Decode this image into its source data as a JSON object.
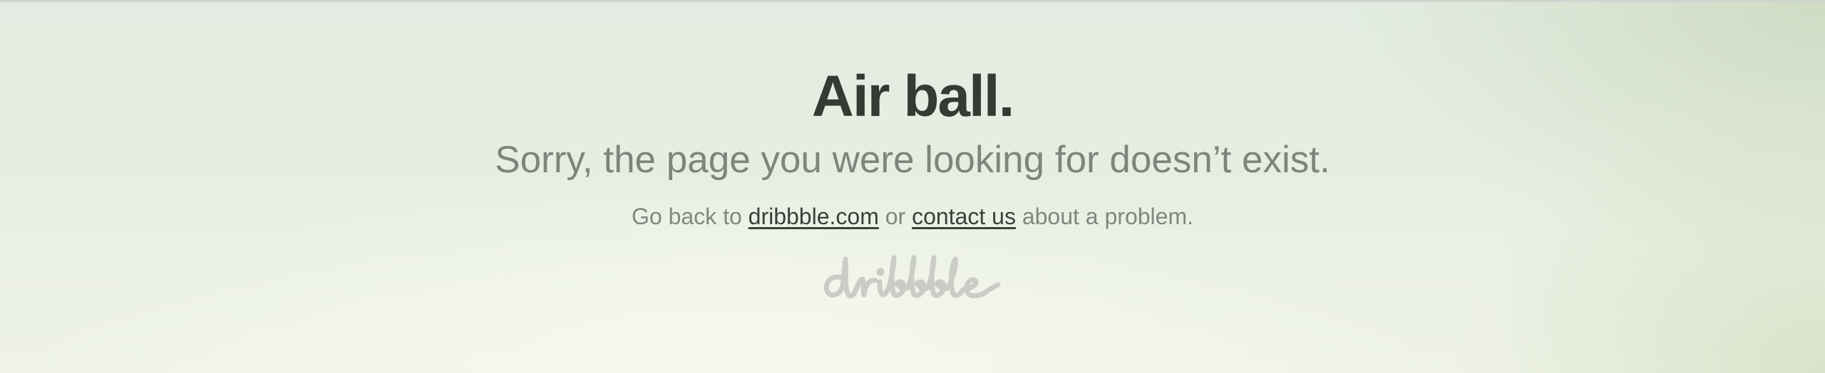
{
  "page": {
    "title": "Air ball.",
    "subtitle": "Sorry, the page you were looking for doesn’t exist.",
    "help": {
      "prefix": "Go back to ",
      "home_link": "dribbble.com",
      "middle": " or ",
      "contact_link": "contact us",
      "suffix": " about a problem."
    },
    "logo_text": "dribbble"
  },
  "colors": {
    "title": "#353a35",
    "subtitle": "#7d857d",
    "link": "#3a403a",
    "logo": "#c9cdc6"
  }
}
